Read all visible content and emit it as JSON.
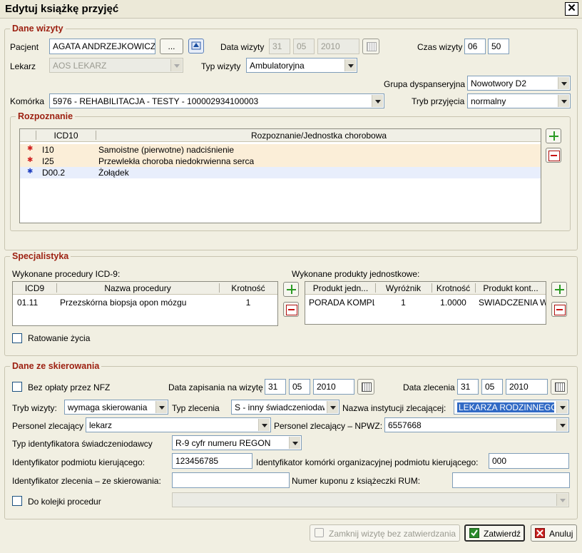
{
  "window": {
    "title": "Edytuj książkę przyjęć",
    "close": "✕"
  },
  "dane_wizyty": {
    "legend": "Dane wizyty",
    "pacjent_label": "Pacjent",
    "pacjent_value": "AGATA ANDRZEJKOWICZ",
    "browse_label": "...",
    "data_wizyty_label": "Data wizyty",
    "data_dd": "31",
    "data_mm": "05",
    "data_yyyy": "2010",
    "czas_label": "Czas wizyty",
    "czas_hh": "06",
    "czas_mm": "50",
    "lekarz_label": "Lekarz",
    "lekarz_value": "AOS LEKARZ",
    "typ_wizyty_label": "Typ wizyty",
    "typ_wizyty_value": "Ambulatoryjna",
    "grupa_label": "Grupa dyspanseryjna",
    "grupa_value": "Nowotwory D2",
    "komorka_label": "Komórka",
    "komorka_value": "5976 - REHABILITACJA - TESTY - 100002934100003",
    "tryb_przyjecia_label": "Tryb przyjęcia",
    "tryb_przyjecia_value": "normalny"
  },
  "rozpoznanie": {
    "legend": "Rozpoznanie",
    "columns": [
      "ICD10",
      "Rozpoznanie/Jednostka chorobowa"
    ],
    "rows": [
      {
        "code": "I10",
        "name": "Samoistne (pierwotne) nadciśnienie",
        "star": "✱"
      },
      {
        "code": "I25",
        "name": "Przewlekła choroba niedokrwienna serca",
        "star": "✱"
      },
      {
        "code": "D00.2",
        "name": "Żołądek",
        "star": "✱"
      }
    ],
    "colors": {
      "primary_row": "#fbeed8",
      "secondary_row": "#e8eefc",
      "red_star": "#d02020",
      "blue_star": "#2040c0"
    }
  },
  "specjalistyka": {
    "legend": "Specjalistyka",
    "procedury_label": "Wykonane procedury ICD-9:",
    "procedury_columns": [
      "ICD9",
      "Nazwa procedury",
      "Krotność"
    ],
    "procedury_rows": [
      {
        "icd9": "01.11",
        "nazwa": "Przezskórna biopsja opon mózgu",
        "krotnosc": "1"
      }
    ],
    "produkty_label": "Wykonane produkty jednostkowe:",
    "produkty_columns": [
      "Produkt jedn...",
      "Wyróżnik",
      "Krotność",
      "Produkt kont..."
    ],
    "produkty_rows": [
      {
        "produkt": "PORADA KOMPL",
        "wyroznik": "1",
        "krotnosc": "1.0000",
        "kont": "SWIADCZENIA W"
      }
    ],
    "ratowanie_label": "Ratowanie życia"
  },
  "skierowanie": {
    "legend": "Dane ze skierowania",
    "bez_oplaty_label": "Bez opłaty przez NFZ",
    "data_zapisania_label": "Data zapisania na wizytę",
    "zap_dd": "31",
    "zap_mm": "05",
    "zap_yyyy": "2010",
    "data_zlecenia_label": "Data zlecenia",
    "zl_dd": "31",
    "zl_mm": "05",
    "zl_yyyy": "2010",
    "tryb_wizyty_label": "Tryb wizyty:",
    "tryb_wizyty_value": "wymaga skierowania",
    "typ_zlecenia_label": "Typ zlecenia",
    "typ_zlecenia_value": "S - inny świadczeniodawca",
    "nazwa_inst_label": "Nazwa instytucji zlecającej:",
    "nazwa_inst_value": "LEKARZA RODZINNEGO",
    "personel_label": "Personel zlecający",
    "personel_value": "lekarz",
    "personel_npwz_label": "Personel zlecający – NPWZ:",
    "personel_npwz_value": "6557668",
    "typ_ident_label": "Typ identyfikatora świadczeniodawcy",
    "typ_ident_value": "R-9 cyfr numeru REGON",
    "ident_podm_label": "Identyfikator podmiotu kierującego:",
    "ident_podm_value": "123456785",
    "ident_kom_label": "Identyfikator komórki organizacyjnej podmiotu kierującego:",
    "ident_kom_value": "000",
    "ident_zlec_label": "Identyfikator zlecenia – ze skierowania:",
    "ident_zlec_value": "",
    "kupon_label": "Numer kuponu z książeczki RUM:",
    "kupon_value": "",
    "kolejka_label": "Do kolejki procedur",
    "kolejka_value": ""
  },
  "footer": {
    "zamknij_label": "Zamknij wizytę bez zatwierdzania",
    "zatwierdz_label": "Zatwierdź",
    "anuluj_label": "Anuluj"
  }
}
